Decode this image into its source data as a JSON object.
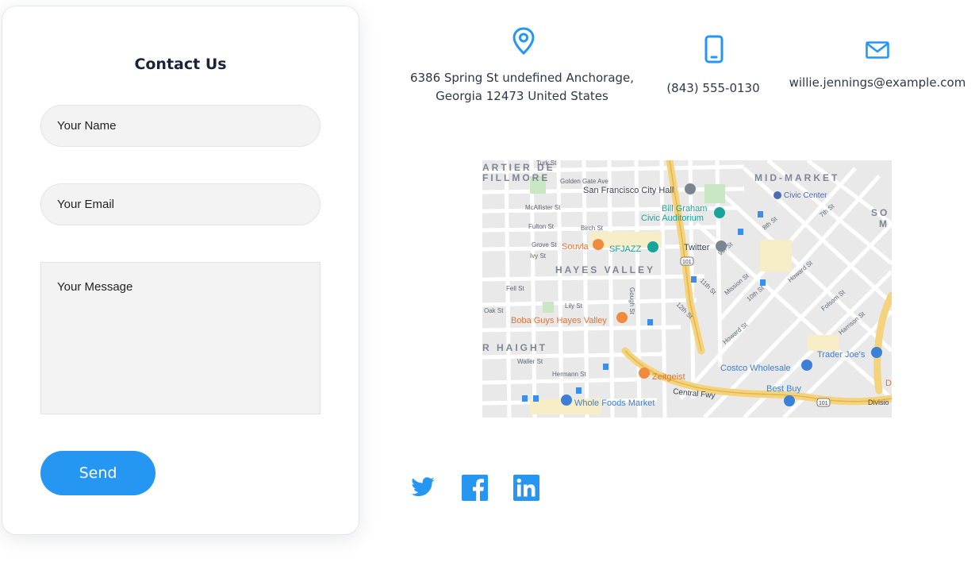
{
  "form": {
    "title": "Contact Us",
    "name_placeholder": "Your Name",
    "email_placeholder": "Your Email",
    "message_placeholder": "Your Message",
    "send_label": "Send"
  },
  "contact": {
    "address_line1": "6386 Spring St undefined Anchorage,",
    "address_line2": "Georgia 12473 United States",
    "phone": "(843) 555-0130",
    "email": "willie.jennings@example.com",
    "icons": [
      "location-pin-icon",
      "phone-icon",
      "mail-icon"
    ]
  },
  "map": {
    "labels": {
      "quartier": "ARTIER DE",
      "fillmore": "FILLMORE",
      "mid_market": "MID-MARKET",
      "so": "SO",
      "ma": "M",
      "turk": "Turk St",
      "golden_gate": "Golden Gate Ave",
      "sf_city_hall": "San Francisco City Hall",
      "civic_center": "Civic Center",
      "bill_graham": "Bill Graham",
      "civic_auditorium": "Civic Auditorium",
      "mcallister": "McAllister St",
      "fulton": "Fulton St",
      "birch": "Birch St",
      "grove": "Grove St",
      "ivy": "Ivy St",
      "souvla": "Souvla",
      "sfjazz": "SFJAZZ",
      "twitter": "Twitter",
      "hayes_valley": "HAYES VALLEY",
      "fell": "Fell St",
      "oak": "Oak St",
      "lily": "Lily St",
      "gough": "Gough St",
      "boba": "Boba Guys Hayes Valley",
      "haight": "R HAIGHT",
      "waller": "Waller St",
      "hermann": "Hermann St",
      "zeitgeist": "Zeitgeist",
      "central_fwy": "Central Fwy",
      "whole_foods": "Whole Foods Market",
      "costco": "Costco Wholesale",
      "best_buy": "Best Buy",
      "trader_joes": "Trader Joe's",
      "mission": "Mission St",
      "tenth": "10th St",
      "eleventh": "11th St",
      "twelfth": "12th St",
      "ninth": "9th St",
      "eighth": "8th St",
      "seventh": "7th St",
      "howard": "Howard St",
      "folsom": "Folsom St",
      "harrison": "Harrison St",
      "route_101": "101",
      "division": "Divisio",
      "d_label": "D"
    }
  },
  "social": {
    "icons": [
      "twitter-icon",
      "facebook-icon",
      "linkedin-icon"
    ]
  },
  "colors": {
    "accent": "#2696f3",
    "text_dark": "#1b2437",
    "field_bg": "#f3f3f3"
  }
}
